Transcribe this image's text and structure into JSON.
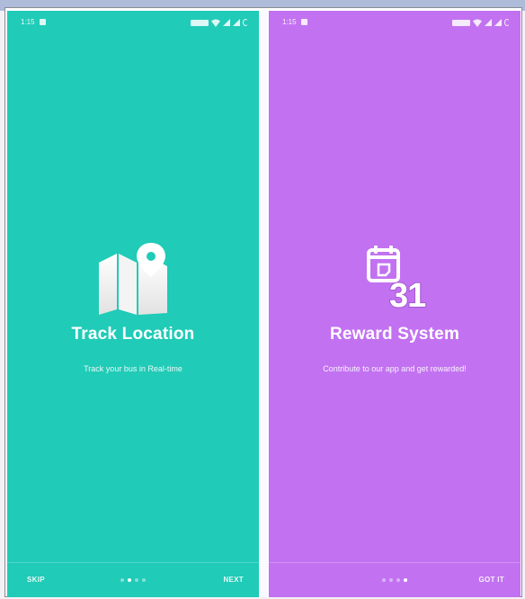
{
  "colors": {
    "teal": "#20cbb7",
    "purple": "#c272f1"
  },
  "screens": [
    {
      "status": {
        "time": "1:15"
      },
      "icon": "map-pin-icon",
      "title": "Track Location",
      "subtitle": "Track your bus in Real-time",
      "left_button": "SKIP",
      "right_button": "NEXT",
      "active_dot": 1,
      "dot_count": 4
    },
    {
      "status": {
        "time": "1:15"
      },
      "icon": "calendar-icon",
      "calendar_number": "31",
      "title": "Reward System",
      "subtitle": "Contribute to our app and get rewarded!",
      "left_button": "",
      "right_button": "GOT IT",
      "active_dot": 3,
      "dot_count": 4
    }
  ]
}
